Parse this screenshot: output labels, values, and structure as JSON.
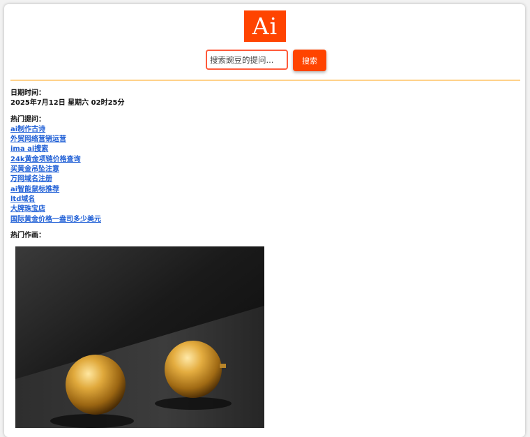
{
  "logo": {
    "text": "Ai",
    "color": "#ff4400"
  },
  "search": {
    "placeholder": "搜索豌豆的提问...",
    "value": "",
    "button_label": "搜索"
  },
  "datetime": {
    "label": "日期时间：",
    "value": "2025年7月12日 星期六 02时25分"
  },
  "hot_questions": {
    "label": "热门提问：",
    "items": [
      "ai制作古诗",
      "外贸网络营销运营",
      "ima ai搜索",
      "24k黄金项链价格查询",
      "买黄金吊坠注意",
      "万网域名注册",
      "ai智能鼠标推荐",
      "ltd域名",
      "大牌珠宝店",
      "国际黄金价格一盎司多少美元"
    ]
  },
  "hot_drawings": {
    "label": "热门作画："
  },
  "colors": {
    "accent": "#ff4400",
    "divider": "#ffd18a",
    "link": "#1f5fd6"
  }
}
